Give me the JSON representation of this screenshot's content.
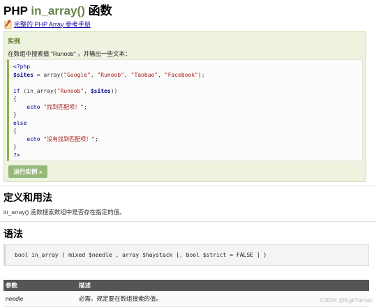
{
  "header": {
    "title_prefix": "PHP ",
    "title_fn": "in_array()",
    "title_suffix": " 函数",
    "manual_link": "完整的 PHP Array 参考手册"
  },
  "example": {
    "title": "实例",
    "description": "在数组中搜索值 \"Runoob\" ，并输出一些文本：",
    "code": {
      "l1": "<?php",
      "l2_var": "$sites",
      "l2_eq": " = ",
      "l2_fn": "array",
      "l2_open": "(",
      "l2_s1": "\"Google\"",
      "l2_c1": ", ",
      "l2_s2": "\"Runoob\"",
      "l2_c2": ", ",
      "l2_s3": "\"Taobao\"",
      "l2_c3": ", ",
      "l2_s4": "\"Facebook\"",
      "l2_close": ");",
      "l4_kw": "if",
      "l4_p1": " (",
      "l4_fn": "in_array",
      "l4_p2": "(",
      "l4_s": "\"Runoob\"",
      "l4_c": ", ",
      "l4_var": "$sites",
      "l4_p3": "))",
      "brace_open": "{",
      "brace_close": "}",
      "l6_indent": "    ",
      "l6_kw": "echo",
      "l6_sp": " ",
      "l6_s": "\"找到匹配项！\"",
      "l6_end": ";",
      "l8_kw": "else",
      "l10_indent": "    ",
      "l10_kw": "echo",
      "l10_sp": " ",
      "l10_s": "\"没有找到匹配项！\"",
      "l10_end": ";",
      "l12": "?>"
    },
    "run_button": "运行实例 »"
  },
  "definition": {
    "heading": "定义和用法",
    "text": "in_array() 函数搜索数组中是否存在指定的值。"
  },
  "syntax": {
    "heading": "语法",
    "code": "bool in_array ( mixed $needle , array $haystack [, bool $strict = FALSE ] )"
  },
  "params": {
    "headers": [
      "参数",
      "描述"
    ],
    "rows": [
      {
        "name": "needle",
        "desc": "必需。规定要在数组搜索的值。"
      }
    ]
  },
  "watermark": "CSDN @KgkTamwc",
  "colors": {
    "title_accent": "#64854c",
    "example_bg": "#eef3df",
    "run_button_bg": "#96b97a",
    "table_header_bg": "#555555"
  },
  "icons": {
    "manual": "arrow-link-icon"
  }
}
